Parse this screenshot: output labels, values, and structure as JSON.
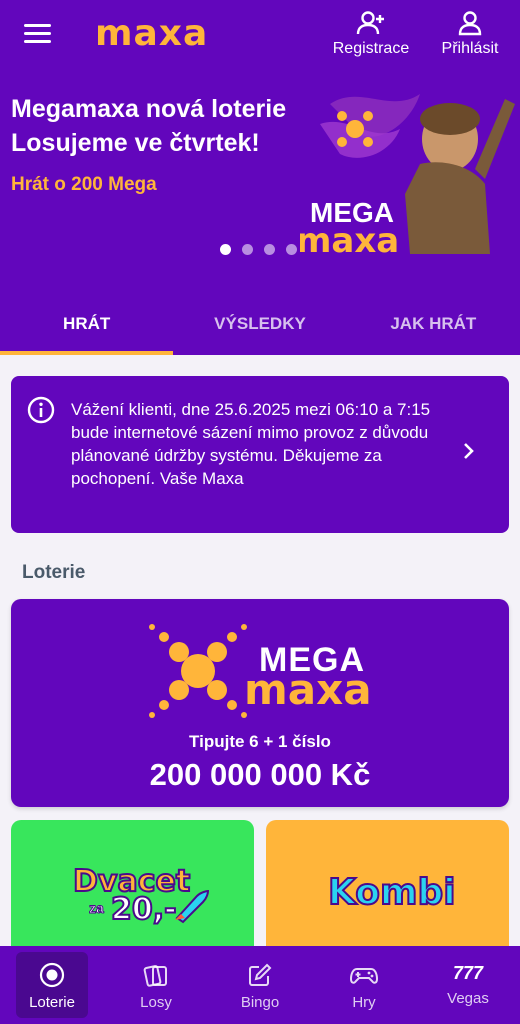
{
  "header": {
    "logo": "maxa",
    "register_label": "Registrace",
    "login_label": "Přihlásit",
    "menu_icon": "hamburger-icon",
    "register_icon": "user-plus-icon",
    "login_icon": "user-icon"
  },
  "hero": {
    "title_line1": "Megamaxa nová loterie",
    "title_line2": "Losujeme ve čtvrtek!",
    "subtitle": "Hrát o 200 Mega",
    "logo_mega": "MEGA",
    "logo_maxa": "maxa",
    "slides": 4,
    "active_slide": 1
  },
  "tabs": [
    {
      "label": "HRÁT",
      "active": true
    },
    {
      "label": "VÝSLEDKY",
      "active": false
    },
    {
      "label": "JAK HRÁT",
      "active": false
    }
  ],
  "notice": {
    "text": "Vážení klienti, dne 25.6.2025 mezi 06:10 a 7:15 bude internetové sázení mimo provoz z důvodu plánované údržby systému. Děkujeme za pochopení. Vaše Maxa",
    "icon": "info-icon",
    "chevron": "chevron-right-icon"
  },
  "section": {
    "title": "Loterie"
  },
  "mega_card": {
    "logo_mega": "MEGA",
    "logo_maxa": "maxa",
    "tagline": "Tipujte 6 + 1 číslo",
    "prize": "200 000 000 Kč"
  },
  "cards": {
    "dvacet_title": "Dvacet",
    "dvacet_za": "za",
    "dvacet_price": "20,-",
    "kombi_title": "Kombi"
  },
  "bottom_nav": [
    {
      "label": "Loterie",
      "icon": "lottery-icon",
      "active": true
    },
    {
      "label": "Losy",
      "icon": "tickets-icon",
      "active": false
    },
    {
      "label": "Bingo",
      "icon": "edit-icon",
      "active": false
    },
    {
      "label": "Hry",
      "icon": "gamepad-icon",
      "active": false
    },
    {
      "label": "Vegas",
      "icon": "777-icon",
      "glyph": "777",
      "active": false
    }
  ],
  "colors": {
    "brand_purple": "#6206bc",
    "accent_orange": "#ffb53a",
    "green": "#38e65c",
    "page_bg": "#f4f2f8"
  }
}
